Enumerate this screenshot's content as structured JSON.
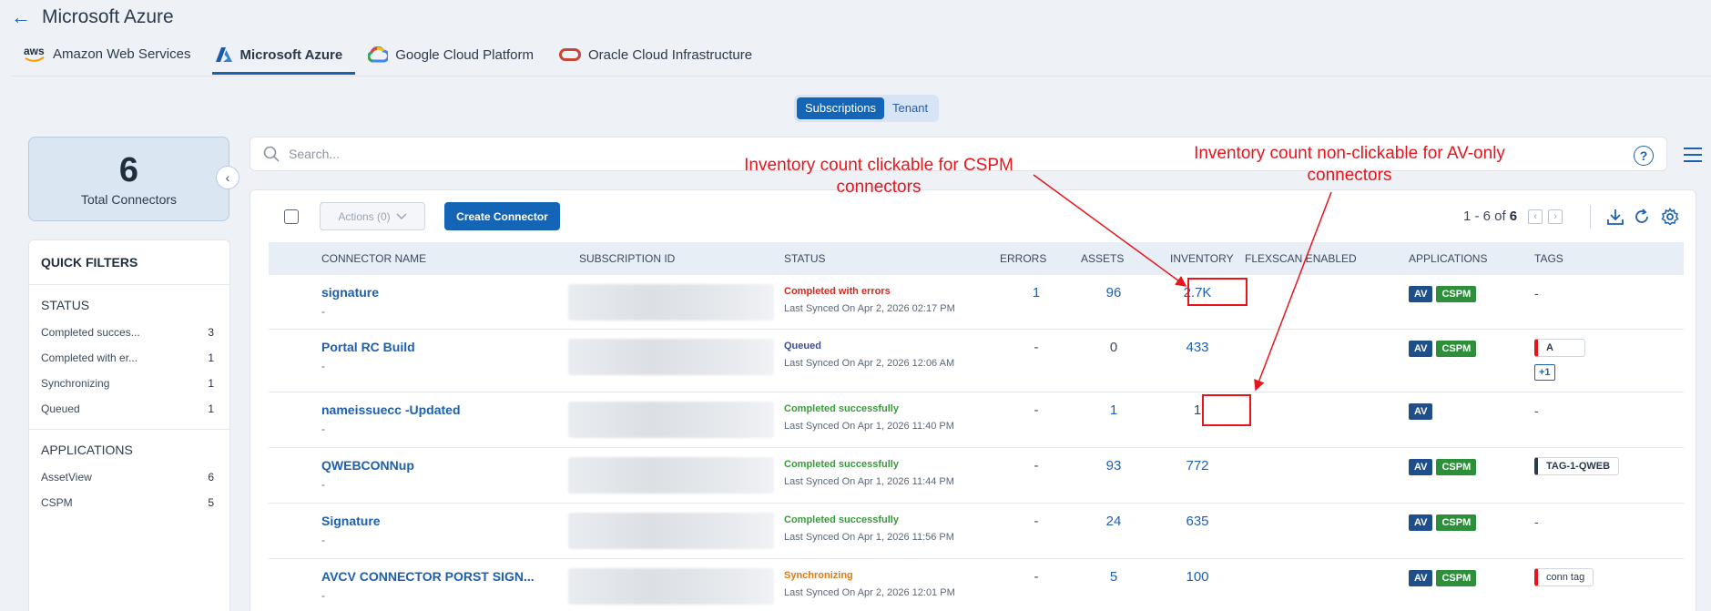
{
  "header": {
    "title": "Microsoft Azure"
  },
  "cloud_tabs": [
    {
      "label": "Amazon Web Services",
      "logo_text": "aws"
    },
    {
      "label": "Microsoft Azure",
      "active": true
    },
    {
      "label": "Google Cloud Platform"
    },
    {
      "label": "Oracle Cloud Infrastructure"
    }
  ],
  "segment": {
    "subscriptions": "Subscriptions",
    "tenant": "Tenant",
    "active": "Subscriptions"
  },
  "summary": {
    "total": "6",
    "label": "Total Connectors"
  },
  "quick_filters": {
    "title": "QUICK FILTERS",
    "status_title": "STATUS",
    "status": [
      {
        "label": "Completed succes...",
        "count": "3"
      },
      {
        "label": "Completed with er...",
        "count": "1"
      },
      {
        "label": "Synchronizing",
        "count": "1"
      },
      {
        "label": "Queued",
        "count": "1"
      }
    ],
    "applications_title": "APPLICATIONS",
    "applications": [
      {
        "label": "AssetView",
        "count": "6"
      },
      {
        "label": "CSPM",
        "count": "5"
      }
    ]
  },
  "search": {
    "placeholder": "Search..."
  },
  "toolbar": {
    "actions_label": "Actions (0)",
    "create_label": "Create Connector",
    "pager_range": "1 - 6 of",
    "pager_total": "6"
  },
  "columns": {
    "name": "CONNECTOR NAME",
    "subscription": "SUBSCRIPTION ID",
    "status": "STATUS",
    "errors": "ERRORS",
    "assets": "ASSETS",
    "inventory": "INVENTORY",
    "flexscan": "FLEXSCAN ENABLED",
    "applications": "APPLICATIONS",
    "tags": "TAGS"
  },
  "rows": [
    {
      "name": "signature",
      "desc": "-",
      "status": "Completed with errors",
      "status_color": "#d0291d",
      "sync": "Last Synced On Apr 2, 2026 02:17 PM",
      "errors": "1",
      "assets": "96",
      "inventory": "2.7K",
      "apps": [
        "AV",
        "CSPM"
      ],
      "tag": "-",
      "tag_more": ""
    },
    {
      "name": "Portal RC Build",
      "desc": "-",
      "status": "Queued",
      "status_color": "#3d4d9a",
      "sync": "Last Synced On Apr 2, 2026 12:06 AM",
      "errors": "-",
      "assets": "0",
      "inventory": "433",
      "apps": [
        "AV",
        "CSPM"
      ],
      "tag": "A",
      "tag_color": "#e8141c",
      "tag_more": "+1"
    },
    {
      "name": "nameissuecc -Updated",
      "desc": "-",
      "status": "Completed successfully",
      "status_color": "#3a9a3a",
      "sync": "Last Synced On Apr 1, 2026 11:40 PM",
      "errors": "-",
      "assets": "1",
      "inventory": "1",
      "apps": [
        "AV"
      ],
      "tag": "-",
      "tag_more": ""
    },
    {
      "name": "QWEBCONNup",
      "desc": "-",
      "status": "Completed successfully",
      "status_color": "#3a9a3a",
      "sync": "Last Synced On Apr 1, 2026 11:44 PM",
      "errors": "-",
      "assets": "93",
      "inventory": "772",
      "apps": [
        "AV",
        "CSPM"
      ],
      "tag": "TAG-1-QWEB",
      "tag_color": "#2c3a4b",
      "tag_more": ""
    },
    {
      "name": "Signature",
      "desc": "-",
      "status": "Completed successfully",
      "status_color": "#3a9a3a",
      "sync": "Last Synced On Apr 1, 2026 11:56 PM",
      "errors": "-",
      "assets": "24",
      "inventory": "635",
      "apps": [
        "AV",
        "CSPM"
      ],
      "tag": "-",
      "tag_more": ""
    },
    {
      "name": "AVCV CONNECTOR PORST SIGN...",
      "desc": "-",
      "status": "Synchronizing",
      "status_color": "#e07a14",
      "sync": "Last Synced On Apr 2, 2026 12:01 PM",
      "errors": "-",
      "assets": "5",
      "inventory": "100",
      "apps": [
        "AV",
        "CSPM"
      ],
      "tag": "conn tag",
      "tag_color": "#e8141c",
      "tag_more": ""
    }
  ],
  "annotations": {
    "cspm": "Inventory count clickable for CSPM connectors",
    "av_only": "Inventory count non-clickable for AV-only connectors"
  }
}
